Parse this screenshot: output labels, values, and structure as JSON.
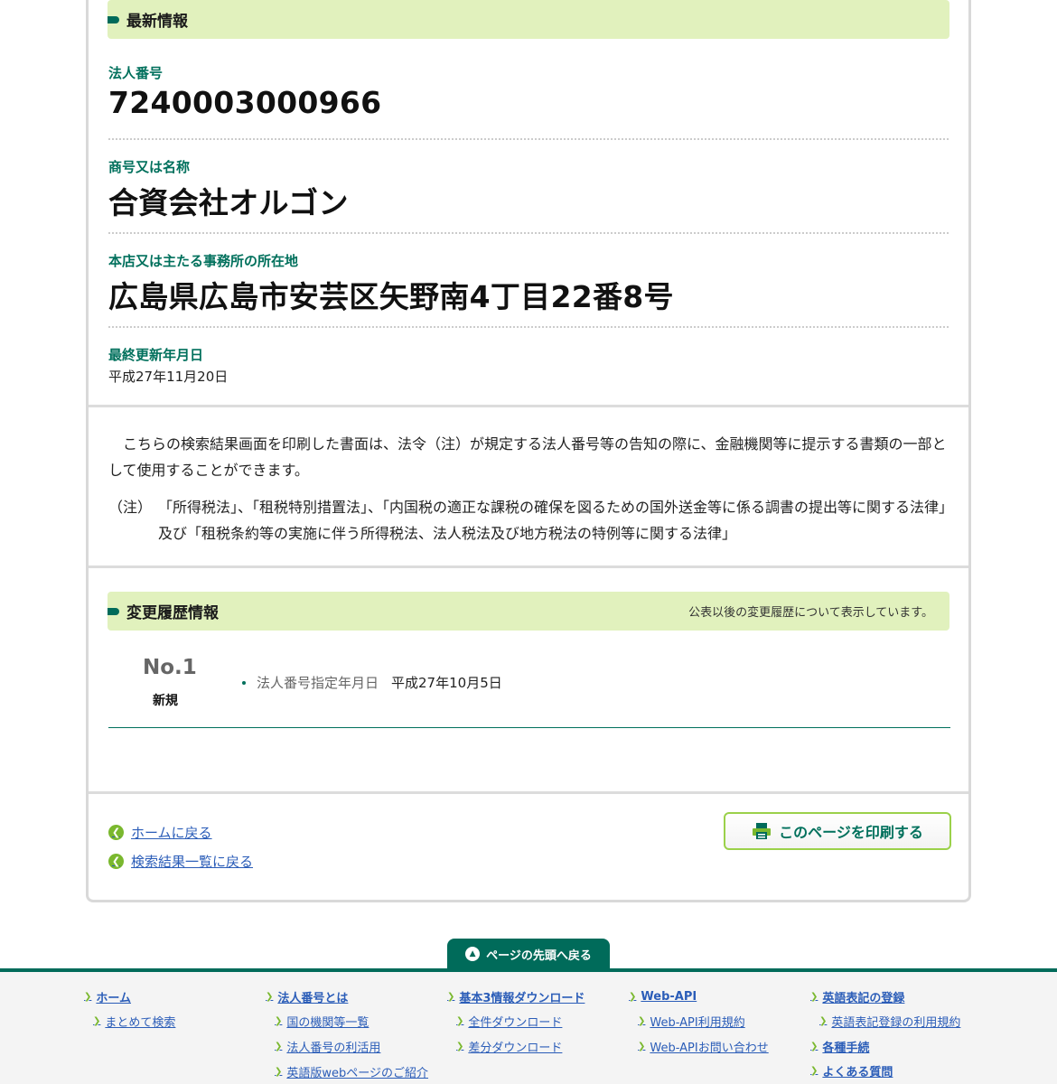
{
  "latest": {
    "heading": "最新情報",
    "corp_number_label": "法人番号",
    "corp_number": "7240003000966",
    "name_label": "商号又は名称",
    "name": "合資会社オルゴン",
    "address_label": "本店又は主たる事務所の所在地",
    "address": "広島県広島市安芸区矢野南4丁目22番8号",
    "updated_label": "最終更新年月日",
    "updated": "平成27年11月20日"
  },
  "notice": {
    "text1": "こちらの検索結果画面を印刷した書面は、法令（注）が規定する法人番号等の告知の際に、金融機関等に提示する書類の一部として使用することができます。",
    "note_tag": "（注）",
    "note_text": "「所得税法」、「租税特別措置法」、「内国税の適正な課税の確保を図るための国外送金等に係る調書の提出等に関する法律」及び「租税条約等の実施に伴う所得税法、法人税法及び地方税法の特例等に関する法律」"
  },
  "history": {
    "heading": "変更履歴情報",
    "note": "公表以後の変更履歴について表示しています。",
    "entries": [
      {
        "no": "No.1",
        "type": "新規",
        "item_label": "法人番号指定年月日",
        "item_value": "平成27年10月5日"
      }
    ]
  },
  "nav": {
    "home_link": "ホームに戻る",
    "results_link": "検索結果一覧に戻る",
    "print_button": "このページを印刷する"
  },
  "pagetop": "ページの先頭へ戻る",
  "footer": {
    "columns": [
      {
        "main": "ホーム",
        "subs": [
          "まとめて検索"
        ]
      },
      {
        "main": "法人番号とは",
        "subs": [
          "国の機関等一覧",
          "法人番号の利活用",
          "英語版webページのご紹介"
        ]
      },
      {
        "main": "基本3情報ダウンロード",
        "subs": [
          "全件ダウンロード",
          "差分ダウンロード"
        ]
      },
      {
        "main": "Web-API",
        "subs": [
          "Web-API利用規約",
          "Web-APIお問い合わせ"
        ]
      },
      {
        "main": "英語表記の登録",
        "subs": [
          "英語表記登録の利用規約"
        ],
        "extra": [
          "各種手続",
          "よくある質問"
        ]
      }
    ]
  },
  "colors": {
    "accent": "#006b5a",
    "heading_bg": "#e1f1bd",
    "link": "#2b5db8",
    "green_icon": "#7ab82e"
  }
}
